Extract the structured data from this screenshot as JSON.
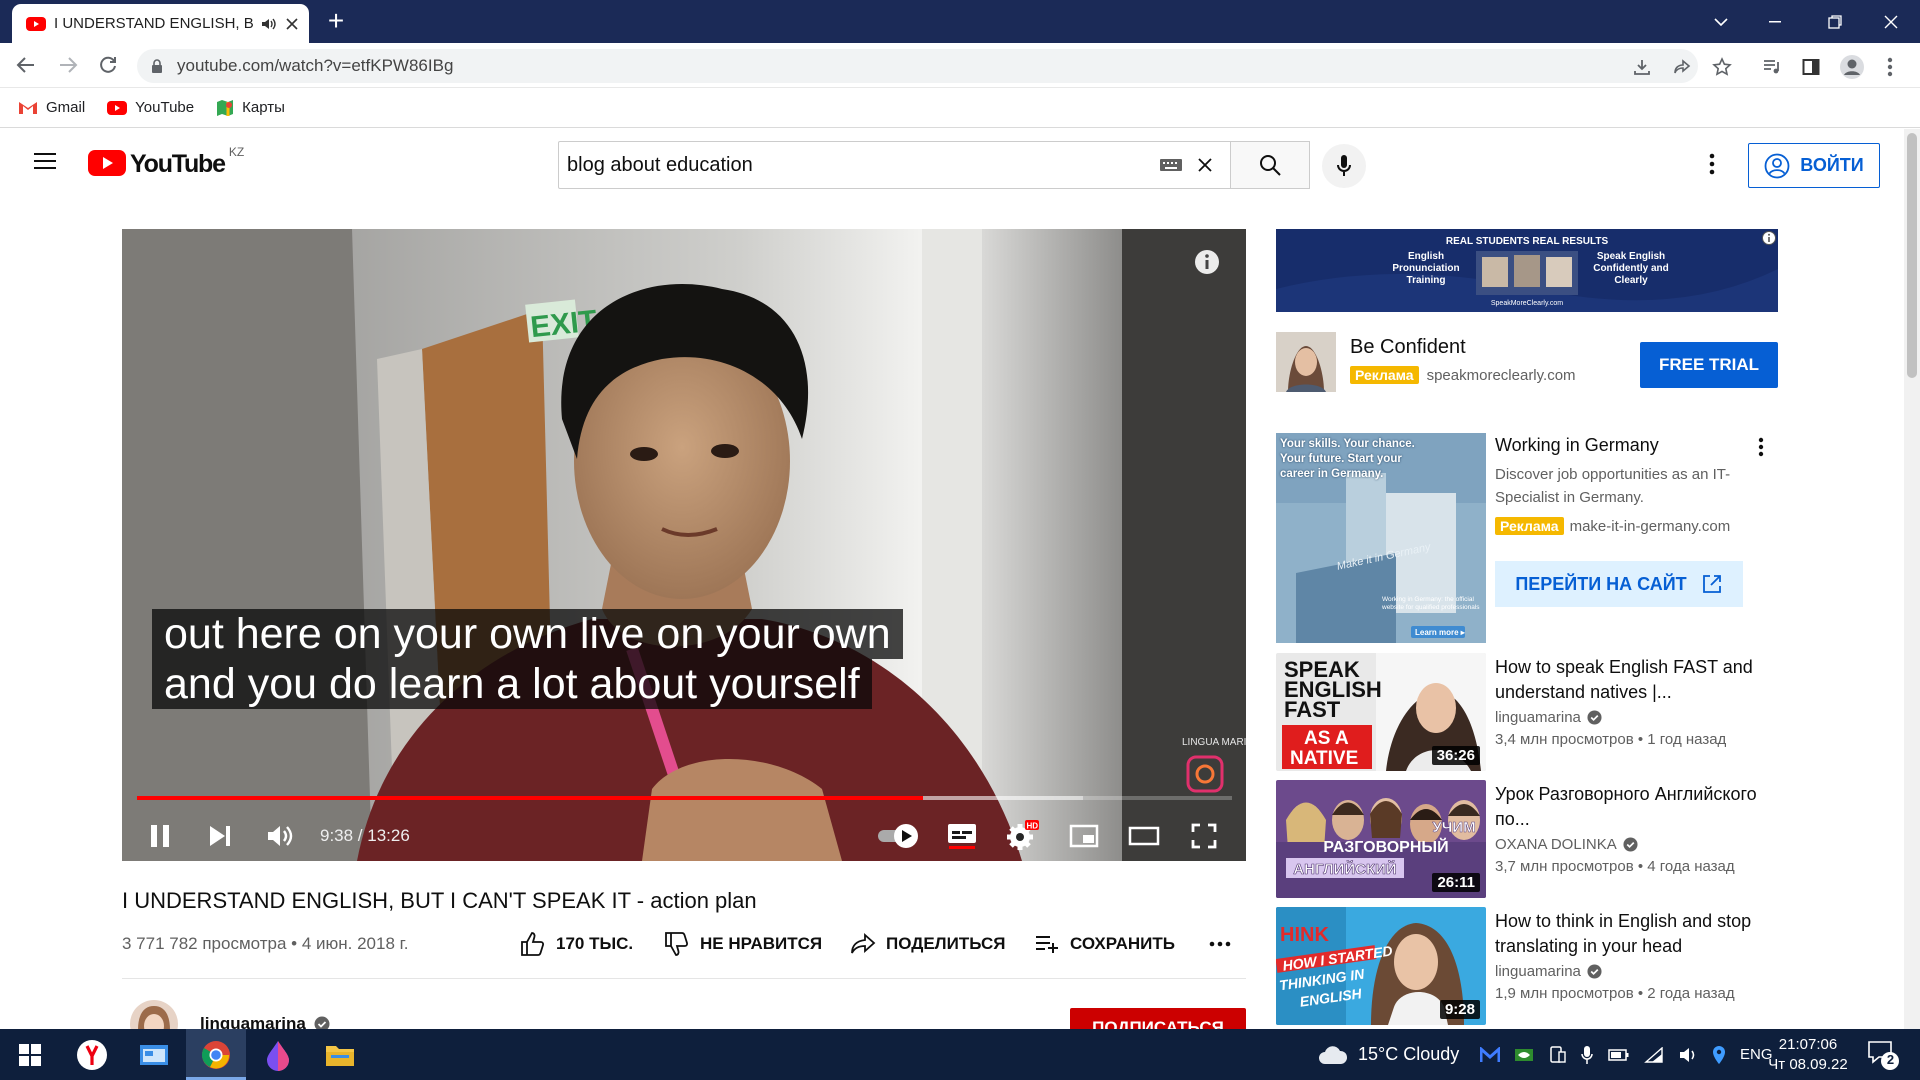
{
  "note": "Computer-use screenshot of YouTube watch page in Chrome (Windows). Source screenshot 1568x882 scaled to 1920x1080.",
  "browser": {
    "tab_title": "I UNDERSTAND ENGLISH, BU",
    "url": "youtube.com/watch?v=etfKPW86IBg",
    "bookmarks": [
      {
        "label": "Gmail",
        "icon": "gmail-icon"
      },
      {
        "label": "YouTube",
        "icon": "youtube-icon"
      },
      {
        "label": "Карты",
        "icon": "maps-icon"
      }
    ]
  },
  "header": {
    "logo_text": "YouTube",
    "country_code": "KZ",
    "search_query": "blog about education",
    "login_label": "ВОЙТИ"
  },
  "player": {
    "subtitle_lines": [
      "out here on your own live on your own",
      "and you do learn a lot about yourself"
    ],
    "current_time": "9:38",
    "duration": "13:26",
    "time_display": "9:38 / 13:26",
    "progress_fraction": 0.718,
    "buffered_fraction": 0.864,
    "watermark": "LINGUA MARINA",
    "sign_text": "EXIT"
  },
  "video": {
    "title": "I UNDERSTAND ENGLISH, BUT I CAN'T SPEAK IT - action plan",
    "meta": "3 771 782 просмотра • 4 июн. 2018 г.",
    "likes": "170 ТЫС.",
    "dislike_label": "НЕ НРАВИТСЯ",
    "share_label": "ПОДЕЛИТЬСЯ",
    "save_label": "СОХРАНИТЬ",
    "channel": "linguamarina",
    "subscribe_label": "ПОДПИСАТЬСЯ"
  },
  "sidebar": {
    "banner": {
      "headline": "REAL STUDENTS REAL RESULTS",
      "left": "English Pronunciation Training",
      "right": "Speak English Confidently and Clearly",
      "site": "SpeakMoreClearly.com"
    },
    "ad": {
      "name": "Be Confident",
      "badge": "Реклама",
      "site": "speakmoreclearly.com",
      "cta": "FREE TRIAL"
    },
    "promo": {
      "title": "Working in Germany",
      "description": "Discover job opportunities as an IT-Specialist in Germany.",
      "badge": "Реклама",
      "site": "make-it-in-germany.com",
      "cta": "ПЕРЕЙТИ НА САЙТ",
      "thumb_text": "Your skills. Your chance. Your future. Start your career in Germany.",
      "thumb_small": "Working in Germany: the official website for qualified professionals",
      "thumb_btn": "Learn more ▸",
      "thumb_sign": "Make it in Germany"
    },
    "recommendations": [
      {
        "title": "How to speak English FAST and understand natives |...",
        "channel": "linguamarina",
        "stats": "3,4 млн просмотров • 1 год назад",
        "duration": "36:26",
        "thumb_lines": [
          "SPEAK",
          "ENGLISH",
          "FAST"
        ],
        "thumb_tag": [
          "AS A",
          "NATIVE"
        ]
      },
      {
        "title": "Урок Разговорного Английского по...",
        "channel": "OXANA DOLINKA",
        "stats": "3,7 млн просмотров • 4 года назад",
        "duration": "26:11",
        "thumb_lines": [
          "УЧИМ",
          "РАЗГОВОРНЫЙ",
          "АНГЛИЙСКИЙ"
        ]
      },
      {
        "title": "How to think in English and stop translating in your head",
        "channel": "linguamarina",
        "stats": "1,9 млн просмотров • 2 года назад",
        "duration": "9:28",
        "thumb_lines": [
          "HOW I STARTED",
          "THINKING IN",
          "ENGLISH"
        ],
        "thumb_tag": [
          "HINK"
        ]
      }
    ]
  },
  "taskbar": {
    "weather": "15°C  Cloudy",
    "lang": "ENG",
    "time": "21:07:06",
    "date": "Чт 08.09.22",
    "notifications": "2"
  }
}
